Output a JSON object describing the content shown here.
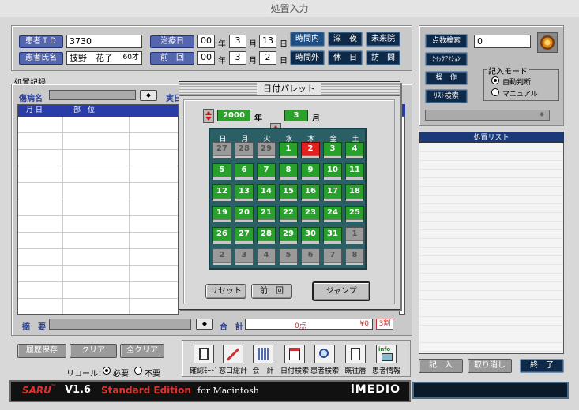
{
  "window": {
    "title": "処置入力"
  },
  "patient": {
    "id_label": "患者ＩＤ",
    "id_value": "3730",
    "name_label": "患者氏名",
    "name_value": "披野　花子",
    "age": "60才",
    "date_label": "治療日",
    "prev_label": "前　回",
    "date": {
      "y": "00",
      "y_unit": "年",
      "m": "3",
      "m_unit": "月",
      "d": "13",
      "d_unit": "日"
    },
    "prev": {
      "y": "00",
      "y_unit": "年",
      "m": "3",
      "m_unit": "月",
      "d": "2",
      "d_unit": "日"
    }
  },
  "time_buttons": [
    "時間内",
    "深　夜",
    "未来院",
    "時間外",
    "休　日",
    "訪　問"
  ],
  "record": {
    "section_label": "処置記録",
    "disease_label": "傷病名",
    "actual_label": "実日",
    "col_month_day": "月 日",
    "col_part": "部　位",
    "summary_label": "摘　要",
    "total_label": "合　計",
    "points": "0点",
    "yen": "¥0",
    "ratio": "3割"
  },
  "palette": {
    "title": "日付パレット",
    "year": "2000",
    "year_unit": "年",
    "month": "3",
    "month_unit": "月",
    "weekdays": [
      "日",
      "月",
      "火",
      "水",
      "木",
      "金",
      "土"
    ],
    "weeks": [
      [
        {
          "d": "27",
          "t": "oth"
        },
        {
          "d": "28",
          "t": "oth"
        },
        {
          "d": "29",
          "t": "oth"
        },
        {
          "d": "1",
          "t": "cur"
        },
        {
          "d": "2",
          "t": "sel"
        },
        {
          "d": "3",
          "t": "cur"
        },
        {
          "d": "4",
          "t": "cur"
        }
      ],
      [
        {
          "d": "5",
          "t": "cur"
        },
        {
          "d": "6",
          "t": "cur"
        },
        {
          "d": "7",
          "t": "cur"
        },
        {
          "d": "8",
          "t": "cur"
        },
        {
          "d": "9",
          "t": "cur"
        },
        {
          "d": "10",
          "t": "cur"
        },
        {
          "d": "11",
          "t": "cur"
        }
      ],
      [
        {
          "d": "12",
          "t": "cur"
        },
        {
          "d": "13",
          "t": "cur"
        },
        {
          "d": "14",
          "t": "cur"
        },
        {
          "d": "15",
          "t": "cur"
        },
        {
          "d": "16",
          "t": "cur"
        },
        {
          "d": "17",
          "t": "cur"
        },
        {
          "d": "18",
          "t": "cur"
        }
      ],
      [
        {
          "d": "19",
          "t": "cur"
        },
        {
          "d": "20",
          "t": "cur"
        },
        {
          "d": "21",
          "t": "cur"
        },
        {
          "d": "22",
          "t": "cur"
        },
        {
          "d": "23",
          "t": "cur"
        },
        {
          "d": "24",
          "t": "cur"
        },
        {
          "d": "25",
          "t": "cur"
        }
      ],
      [
        {
          "d": "26",
          "t": "cur"
        },
        {
          "d": "27",
          "t": "cur"
        },
        {
          "d": "28",
          "t": "cur"
        },
        {
          "d": "29",
          "t": "cur"
        },
        {
          "d": "30",
          "t": "cur"
        },
        {
          "d": "31",
          "t": "cur"
        },
        {
          "d": "1",
          "t": "oth"
        }
      ],
      [
        {
          "d": "2",
          "t": "oth"
        },
        {
          "d": "3",
          "t": "oth"
        },
        {
          "d": "4",
          "t": "oth"
        },
        {
          "d": "5",
          "t": "oth"
        },
        {
          "d": "6",
          "t": "oth"
        },
        {
          "d": "7",
          "t": "oth"
        },
        {
          "d": "8",
          "t": "oth"
        }
      ]
    ],
    "reset_label": "リセット",
    "prev_label": "前　回",
    "jump_label": "ジャンプ"
  },
  "right": {
    "search_points": "点数検索",
    "quick_action": "ｸｲｯｸｱｸｼｮﾝ",
    "manipulation": "操　作",
    "list_search": "ﾘｽﾄ検索",
    "input_value": "0",
    "mode_label": "記入モード",
    "mode_auto": "自動判断",
    "mode_manual": "マニュアル",
    "list_title": "処置リスト",
    "enter": "記　入",
    "cancel": "取り消し",
    "done": "終　了"
  },
  "bottom": {
    "save_history": "履歴保存",
    "clear": "クリア",
    "clear_all": "全クリア",
    "recall_label": "リコール：",
    "recall_req": "必要",
    "recall_no": "不要",
    "tools": [
      "確認ﾓｰﾄﾞ",
      "窓口総計",
      "会　計",
      "日付検索",
      "患者検索",
      "既往暦",
      "患者情報"
    ],
    "product": "SARU",
    "tm": "™",
    "version": "V1.6",
    "edition": "Standard Edition",
    "platform": "for Macintosh",
    "brand": "iMEDIO",
    "info_icon_text": "info"
  }
}
